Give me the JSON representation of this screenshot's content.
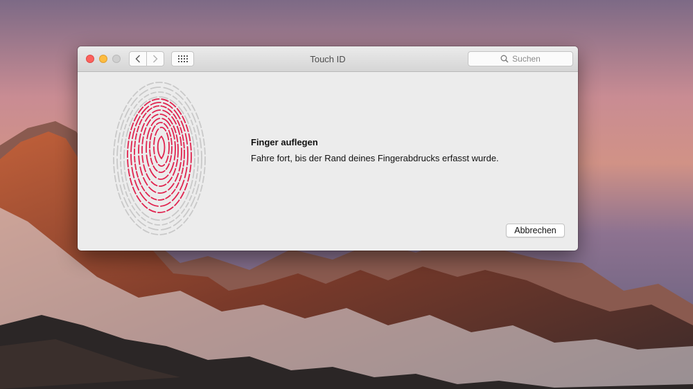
{
  "window": {
    "title": "Touch ID",
    "search_placeholder": "Suchen"
  },
  "icons": {
    "close": "close-traffic-light",
    "minimize": "minimize-traffic-light",
    "zoom": "zoom-traffic-light",
    "back": "chevron-left-icon",
    "forward": "chevron-right-icon",
    "show_all": "grid-icon",
    "search": "magnifier-icon",
    "fingerprint": "fingerprint-icon"
  },
  "content": {
    "heading": "Finger auflegen",
    "message": "Fahre fort, bis der Rand deines Fingerabdrucks erfasst wurde."
  },
  "buttons": {
    "cancel": "Abbrechen"
  },
  "colors": {
    "close": "#fc615d",
    "minimize": "#fdbc40",
    "zoom_disabled": "#cfcfcf",
    "fingerprint_captured": "#e0244f",
    "fingerprint_pending": "#c9c9c9"
  }
}
